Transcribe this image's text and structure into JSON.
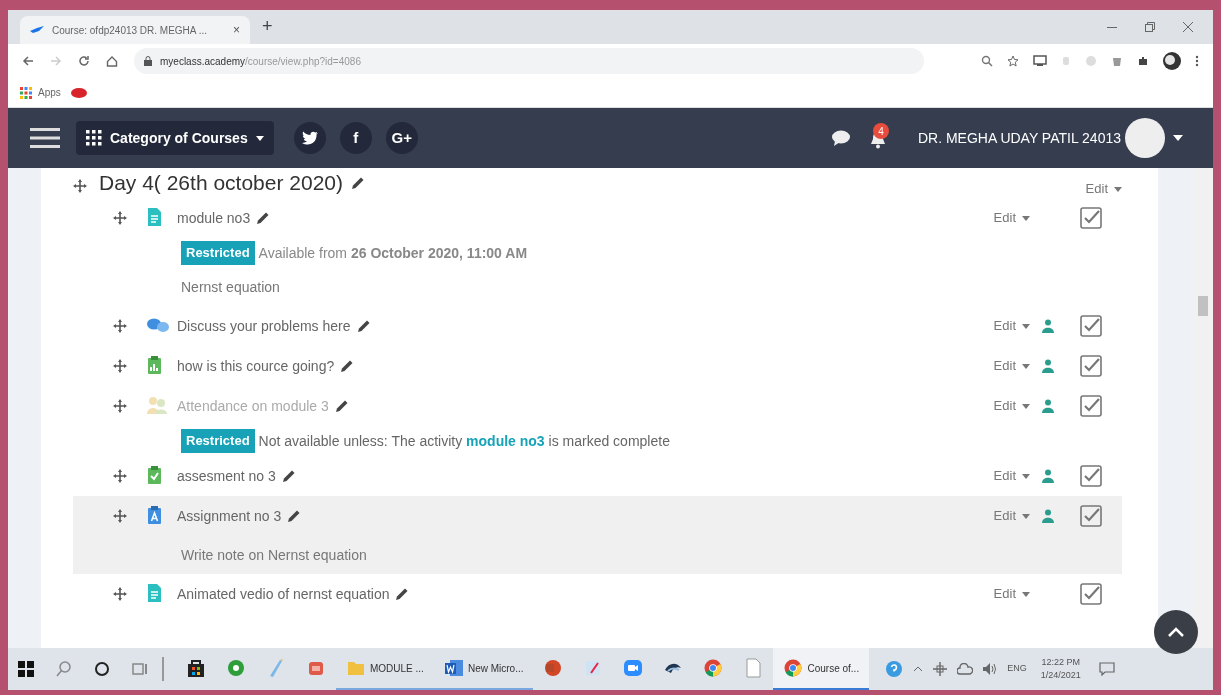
{
  "browser": {
    "tab_title": "Course: ofdp24013 DR. MEGHA ...",
    "tab_close": "×",
    "new_tab": "+",
    "url_host": "myeclass.academy",
    "url_path": "/course/view.php?id=4086",
    "bookmarks": [
      {
        "label": "Apps"
      }
    ]
  },
  "navbar": {
    "menu_label": "Category of Courses",
    "social": [
      {
        "kind": "twitter"
      },
      {
        "kind": "text",
        "label": "f"
      },
      {
        "kind": "text",
        "label": "G+"
      }
    ],
    "notifications": "4",
    "user_name": "DR. MEGHA UDAY PATIL 24013"
  },
  "section": {
    "title": "Day 4( 26th october 2020)",
    "edit": "Edit",
    "items": [
      {
        "kind": "page",
        "name": "module no3",
        "edit": "Edit",
        "group_mode": false,
        "checked": true,
        "dimmed": false,
        "highlighted": false,
        "restriction": {
          "badge": "Restricted",
          "kind": "date",
          "text": "Available from **26 October 2020, 11:00 AM**"
        },
        "description": "Nernst equation"
      },
      {
        "kind": "forum",
        "name": "Discuss your problems here",
        "edit": "Edit",
        "group_mode": true,
        "checked": true,
        "dimmed": false,
        "highlighted": false
      },
      {
        "kind": "feedback",
        "name": "how is this cource going?",
        "edit": "Edit",
        "group_mode": true,
        "checked": true,
        "dimmed": false,
        "highlighted": false
      },
      {
        "kind": "attendance",
        "name": "Attendance on module 3",
        "edit": "Edit",
        "group_mode": true,
        "checked": true,
        "dimmed": true,
        "highlighted": false,
        "restriction": {
          "badge": "Restricted",
          "kind": "activity",
          "text": "Not available unless: The activity",
          "link": "module no3",
          "suffix": "is marked complete"
        }
      },
      {
        "kind": "quiz",
        "name": "assesment no 3",
        "edit": "Edit",
        "group_mode": true,
        "checked": true,
        "dimmed": false,
        "highlighted": false
      },
      {
        "kind": "assignment",
        "name": "Assignment no 3",
        "edit": "Edit",
        "group_mode": true,
        "checked": true,
        "dimmed": false,
        "highlighted": true,
        "description": "Write note on Nernst equation"
      },
      {
        "kind": "page",
        "name": "Animated vedio of nernst equation",
        "edit": "Edit",
        "group_mode": false,
        "checked": true,
        "dimmed": false,
        "highlighted": false
      }
    ]
  },
  "taskbar": {
    "apps": [
      {
        "kind": "store",
        "selected": false
      },
      {
        "kind": "green",
        "selected": false
      },
      {
        "kind": "pen",
        "selected": false
      },
      {
        "kind": "red",
        "selected": false
      },
      {
        "kind": "folder",
        "label": "MODULE ...",
        "selected": false
      },
      {
        "kind": "word",
        "label": "New Micro...",
        "selected": false
      },
      {
        "kind": "powerpoint",
        "selected": false
      },
      {
        "kind": "paint",
        "selected": false
      },
      {
        "kind": "zoom",
        "selected": false
      },
      {
        "kind": "bird",
        "selected": false
      },
      {
        "kind": "chrome",
        "selected": false
      },
      {
        "kind": "file",
        "selected": false
      },
      {
        "kind": "chrome",
        "label": "Course of...",
        "selected": true
      }
    ],
    "lang": "ENG",
    "time": "12:22 PM",
    "date": "1/24/2021"
  }
}
